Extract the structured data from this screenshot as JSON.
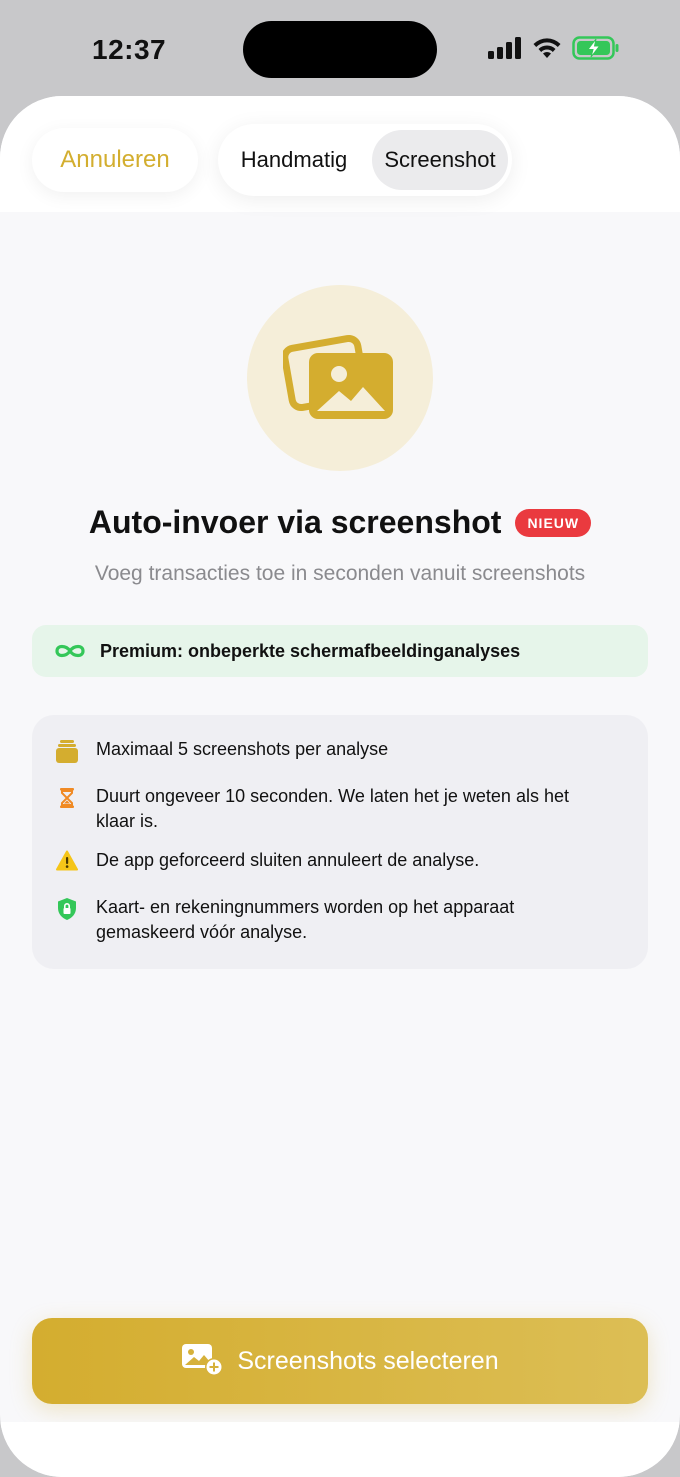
{
  "status_bar": {
    "time": "12:37"
  },
  "header": {
    "cancel_label": "Annuleren",
    "segments": [
      {
        "label": "Handmatig",
        "selected": false
      },
      {
        "label": "Screenshot",
        "selected": true
      }
    ]
  },
  "hero": {
    "icon": "photo-stack-icon",
    "title": "Auto-invoer via screenshot",
    "badge": "NIEUW",
    "subtitle": "Voeg transacties toe in seconden vanuit screenshots"
  },
  "premium": {
    "icon": "infinity-icon",
    "text": "Premium: onbeperkte schermafbeeldinganalyses"
  },
  "info": [
    {
      "icon": "stack-icon",
      "text": "Maximaal 5 screenshots per analyse"
    },
    {
      "icon": "hourglass-icon",
      "text": "Duurt ongeveer 10 seconden. We laten het je weten als het klaar is."
    },
    {
      "icon": "warning-icon",
      "text": "De app geforceerd sluiten annuleert de analyse."
    },
    {
      "icon": "shield-lock-icon",
      "text": "Kaart- en rekeningnummers worden op het apparaat gemaskeerd vóór analyse."
    }
  ],
  "action": {
    "icon": "photo-add-icon",
    "label": "Screenshots selecteren"
  },
  "colors": {
    "accent": "#d4ad2f",
    "badge": "#ea3a3f",
    "premium_bg": "#e6f5ea",
    "premium_icon": "#34c759"
  }
}
